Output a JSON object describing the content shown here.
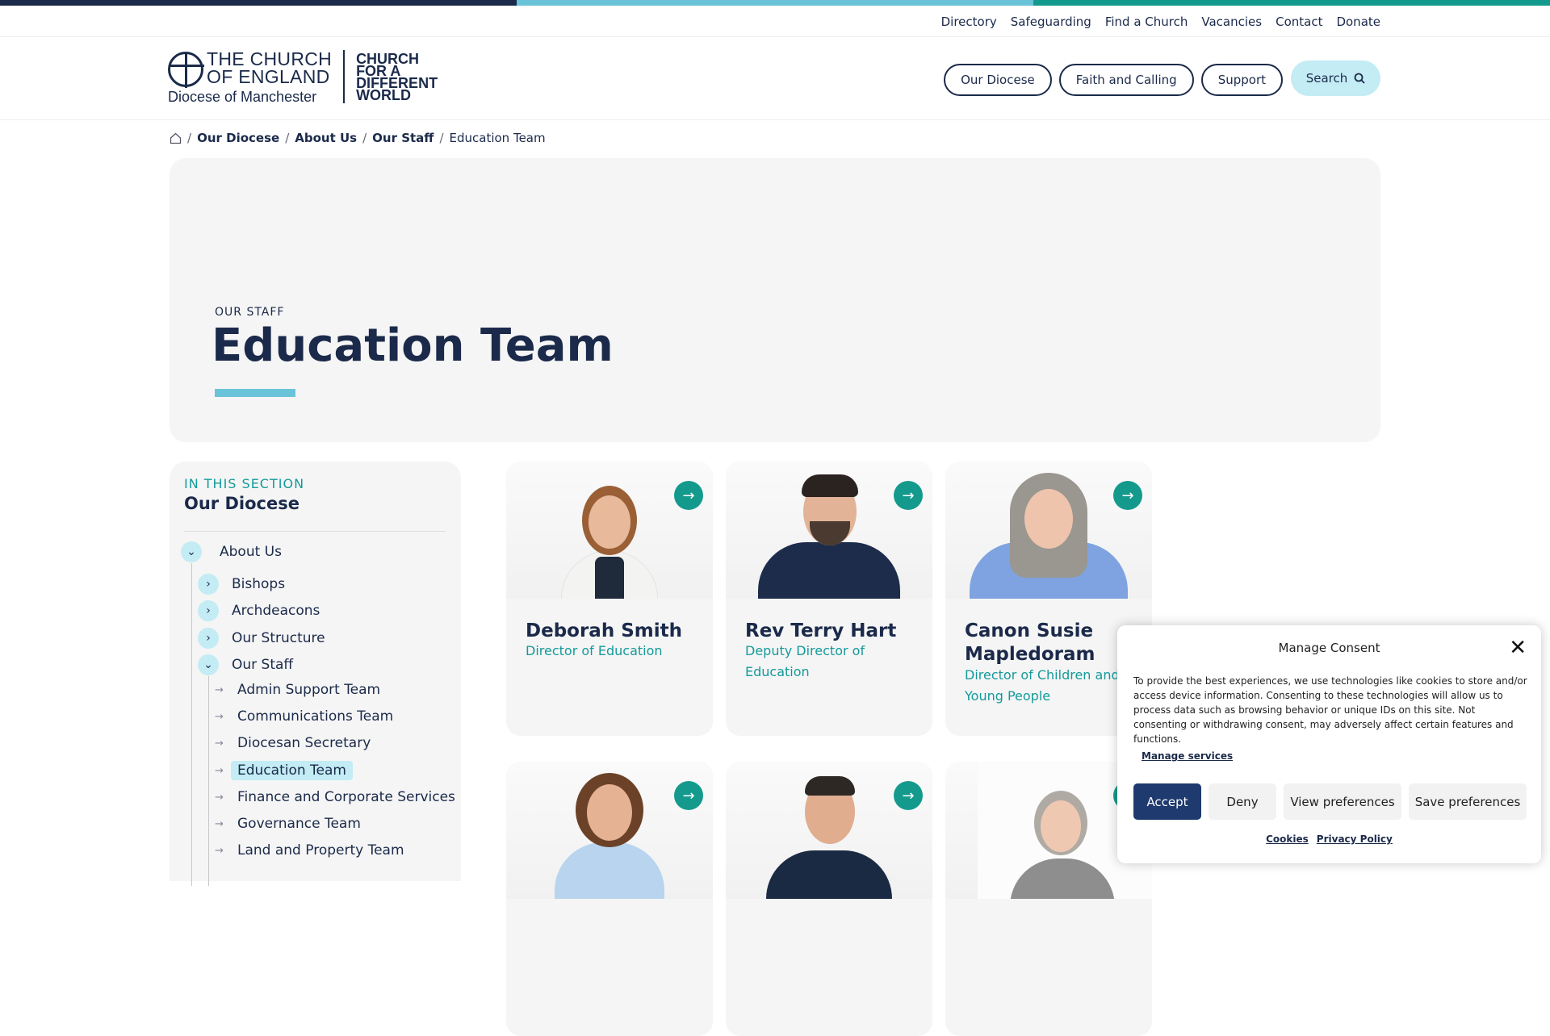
{
  "colors": {
    "navy": "#1b2a4a",
    "light_blue": "#6ac4d9",
    "teal": "#149a8d",
    "pale_blue": "#c3ecf4",
    "topbar": [
      "#1b2a4a",
      "#6ac4d9",
      "#149a8d"
    ]
  },
  "utility_nav": [
    "Directory",
    "Safeguarding",
    "Find a Church",
    "Vacancies",
    "Contact",
    "Donate"
  ],
  "logo": {
    "line1": "THE CHURCH",
    "line2": "OF ENGLAND",
    "line3": "Diocese of Manchester",
    "tagline": "CHURCH FOR A DIFFERENT WORLD"
  },
  "main_nav": [
    "Our Diocese",
    "Faith and Calling",
    "Support"
  ],
  "search": {
    "label": "Search",
    "icon": "search-icon"
  },
  "breadcrumb": {
    "home_icon": "home-icon",
    "items": [
      "Our Diocese",
      "About Us",
      "Our Staff"
    ],
    "current": "Education Team"
  },
  "hero": {
    "kicker": "OUR STAFF",
    "title": "Education Team"
  },
  "sidebar": {
    "section_label": "IN THIS SECTION",
    "section_name": "Our Diocese",
    "parent": "About Us",
    "level1": [
      "Bishops",
      "Archdeacons",
      "Our Structure",
      "Our Staff"
    ],
    "level2": [
      "Admin Support Team",
      "Communications Team",
      "Diocesan Secretary",
      "Education Team",
      "Finance and Corporate Services",
      "Governance Team",
      "Land and Property Team"
    ]
  },
  "cards": [
    {
      "name": "Deborah Smith",
      "role": "Director of Education"
    },
    {
      "name": "Rev Terry Hart",
      "role": "Deputy Director of Education"
    },
    {
      "name": "Canon Susie Mapledoram",
      "role": "Director of Children and Young People"
    }
  ],
  "consent": {
    "title": "Manage Consent",
    "text": "To provide the best experiences, we use technologies like cookies to store and/or access device information. Consenting to these technologies will allow us to process data such as browsing behavior or unique IDs on this site. Not consenting or withdrawing consent, may adversely affect certain features and functions.",
    "manage": "Manage services",
    "buttons": [
      "Accept",
      "Deny",
      "View preferences",
      "Save preferences"
    ],
    "links": [
      "Cookies",
      "Privacy Policy"
    ]
  }
}
